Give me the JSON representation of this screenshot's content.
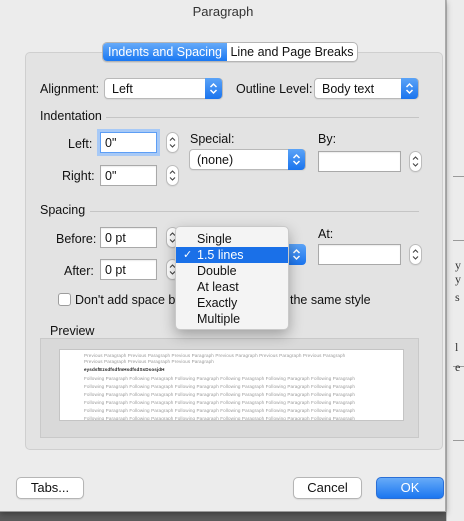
{
  "window": {
    "title": "Paragraph"
  },
  "tabs": [
    {
      "label": "Indents and Spacing",
      "active": true
    },
    {
      "label": "Line and Page Breaks",
      "active": false
    }
  ],
  "general": {
    "alignment_label": "Alignment:",
    "alignment_value": "Left",
    "outline_label": "Outline Level:",
    "outline_value": "Body text"
  },
  "indentation": {
    "heading": "Indentation",
    "left_label": "Left:",
    "left_value": "0\"",
    "right_label": "Right:",
    "right_value": "0\"",
    "special_label": "Special:",
    "special_value": "(none)",
    "by_label": "By:",
    "by_value": ""
  },
  "spacing": {
    "heading": "Spacing",
    "before_label": "Before:",
    "before_value": "0 pt",
    "after_label": "After:",
    "after_value": "0 pt",
    "at_label": "At:",
    "at_value": "",
    "dont_add_label_left": "Don't add space be",
    "dont_add_label_right": "the same style",
    "dont_add_checked": false
  },
  "line_spacing_menu": {
    "items": [
      "Single",
      "1.5 lines",
      "Double",
      "At least",
      "Exactly",
      "Multiple"
    ],
    "selected": "1.5 lines"
  },
  "preview": {
    "heading": "Preview",
    "lines": [
      {
        "text": "Previous Paragraph Previous Paragraph Previous Paragraph Previous Paragraph Previous Paragraph Previous Paragraph",
        "kind": "prev"
      },
      {
        "text": "Previous Paragraph Previous Paragraph Previous Paragraph",
        "kind": "prev"
      },
      {
        "text": "eysdsfEzsdfsdfmHsdfsdSsDsosjdH",
        "kind": "current"
      },
      {
        "text": "Following Paragraph Following Paragraph Following Paragraph Following Paragraph Following Paragraph Following Paragraph",
        "kind": "next"
      },
      {
        "text": "Following Paragraph Following Paragraph Following Paragraph Following Paragraph Following Paragraph Following Paragraph",
        "kind": "next"
      },
      {
        "text": "Following Paragraph Following Paragraph Following Paragraph Following Paragraph Following Paragraph Following Paragraph",
        "kind": "next"
      },
      {
        "text": "Following Paragraph Following Paragraph Following Paragraph Following Paragraph Following Paragraph Following Paragraph",
        "kind": "next"
      },
      {
        "text": "Following Paragraph Following Paragraph Following Paragraph Following Paragraph Following Paragraph Following Paragraph",
        "kind": "next"
      },
      {
        "text": "Following Paragraph Following Paragraph Following Paragraph Following Paragraph Following Paragraph Following Paragraph",
        "kind": "next"
      }
    ]
  },
  "buttons": {
    "tabs": "Tabs...",
    "cancel": "Cancel",
    "ok": "OK"
  },
  "background": {
    "glyphs": [
      "y",
      "y",
      "s",
      "l",
      "e"
    ]
  },
  "colors": {
    "accent": "#1A74EE",
    "selection": "#1A70E8"
  }
}
